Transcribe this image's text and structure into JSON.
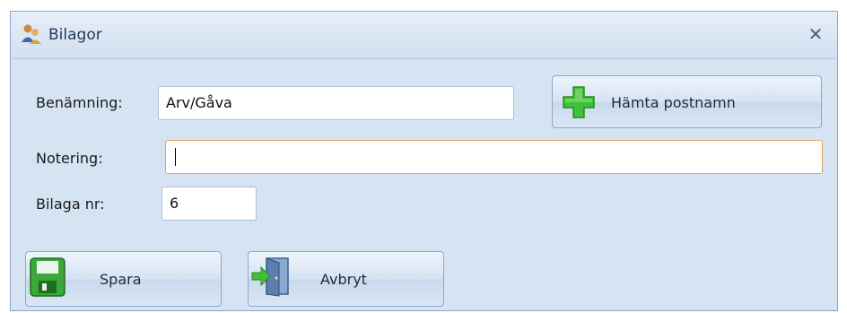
{
  "window": {
    "title": "Bilagor",
    "title_icon": "users-icon",
    "close_icon": "close-icon"
  },
  "form": {
    "benamning_label": "Benämning:",
    "benamning_value": "Arv/Gåva",
    "notering_label": "Notering:",
    "notering_value": "",
    "bilaga_label": "Bilaga nr:",
    "bilaga_value": "6"
  },
  "buttons": {
    "hamta_label": "Hämta postnamn",
    "hamta_icon": "plus-icon",
    "spara_label": "Spara",
    "spara_icon": "save-icon",
    "avbryt_label": "Avbryt",
    "avbryt_icon": "exit-door-icon"
  },
  "colors": {
    "accent_green": "#39b54a",
    "focus_border": "#e3a25b"
  }
}
